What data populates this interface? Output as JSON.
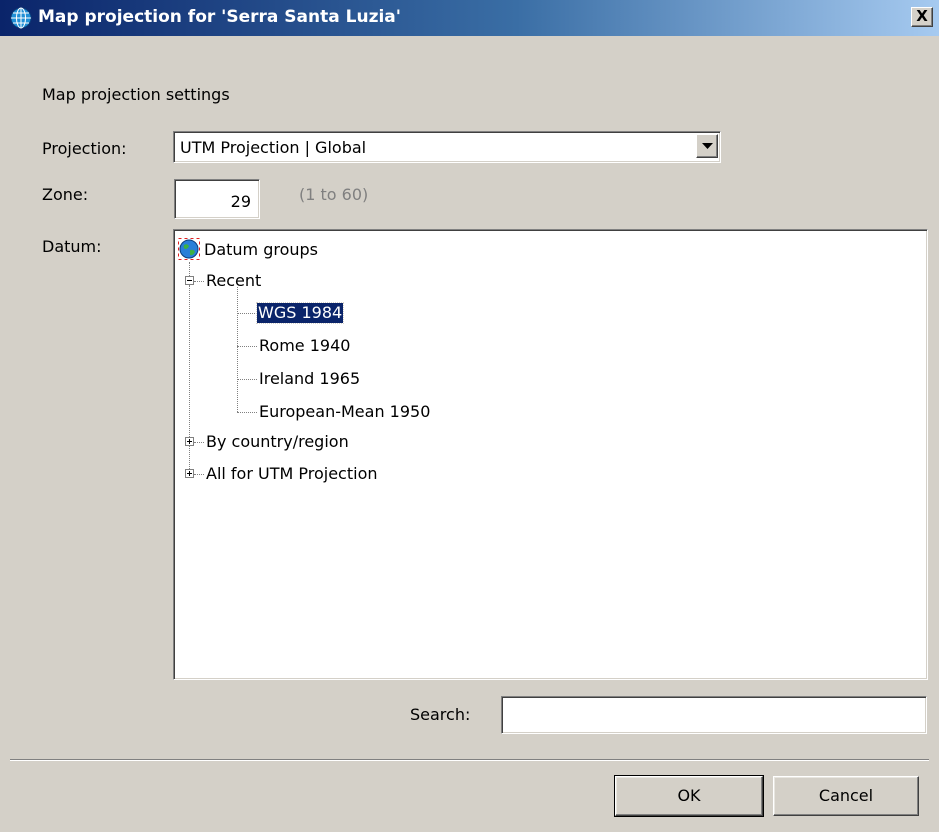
{
  "window": {
    "title": "Map projection for 'Serra Santa Luzia'",
    "close_label": "X"
  },
  "form": {
    "section_label": "Map projection settings",
    "projection_label": "Projection:",
    "projection_value": "UTM Projection | Global",
    "zone_label": "Zone:",
    "zone_value": "29",
    "zone_hint": "(1 to 60)",
    "datum_label": "Datum:"
  },
  "tree": {
    "root": "Datum groups",
    "recent_label": "Recent",
    "recent_items": [
      "WGS 1984",
      "Rome 1940",
      "Ireland 1965",
      "European-Mean 1950"
    ],
    "selected_item": "WGS 1984",
    "by_country_label": "By country/region",
    "all_label": "All for UTM Projection"
  },
  "search": {
    "label": "Search:",
    "value": ""
  },
  "buttons": {
    "ok": "OK",
    "cancel": "Cancel"
  },
  "colors": {
    "title_bar": "#0a246a",
    "selection": "#0a246a",
    "dialog_bg": "#d4d0c8"
  },
  "icons": {
    "title": "globe-grid-icon",
    "tree_root": "earth-globe-icon",
    "combo_arrow": "chevron-down-icon"
  }
}
